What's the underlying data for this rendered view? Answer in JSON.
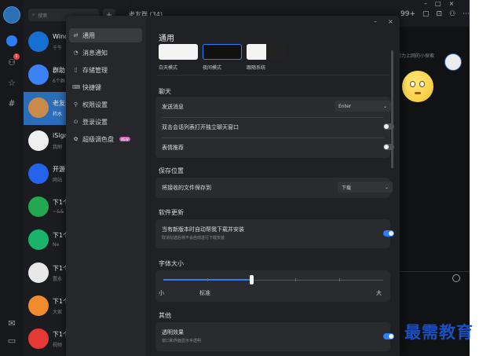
{
  "colors": {
    "accent": "#2e7cf6",
    "badge": "#e54545",
    "panel": "#202124",
    "nav": "#26272b"
  },
  "rail": {
    "unread_badge": "1"
  },
  "search": {
    "placeholder": "搜索"
  },
  "conversations": [
    {
      "name": "Wind",
      "preview": "千牛"
    },
    {
      "name": "群助",
      "preview": "6个群"
    },
    {
      "name": "老友",
      "preview": "药水"
    },
    {
      "name": "iSign",
      "preview": "我刷"
    },
    {
      "name": "开源",
      "preview": "网站"
    },
    {
      "name": "下1个",
      "preview": "~&&"
    },
    {
      "name": "下1个",
      "preview": "Ne"
    },
    {
      "name": "下1个",
      "preview": "置永"
    },
    {
      "name": "下1个",
      "preview": "大家"
    },
    {
      "name": "下1个",
      "preview": "视频"
    }
  ],
  "chat": {
    "title": "老友群 (34)",
    "counter": "99+",
    "side_text": "努力上网的小探索"
  },
  "settings": {
    "nav": [
      {
        "icon": "general-icon",
        "label": "通用"
      },
      {
        "icon": "bell-icon",
        "label": "消息通知"
      },
      {
        "icon": "storage-icon",
        "label": "存储管理"
      },
      {
        "icon": "keyboard-icon",
        "label": "快捷键"
      },
      {
        "icon": "lock-icon",
        "label": "权限设置"
      },
      {
        "icon": "login-icon",
        "label": "登录设置"
      },
      {
        "icon": "palette-icon",
        "label": "超级调色盘",
        "tag": "NEW"
      }
    ],
    "title": "通用",
    "themes": [
      {
        "label": "白天模式"
      },
      {
        "label": "夜间模式",
        "selected": true
      },
      {
        "label": "跟随系统"
      }
    ],
    "chat_section": {
      "title": "聊天",
      "send_label": "发送消息",
      "send_value": "Enter",
      "dblclick_label": "双击会话列表打开独立聊天窗口",
      "dblclick_on": false,
      "emoji_label": "表情推荐",
      "emoji_on": false
    },
    "save_section": {
      "title": "保存位置",
      "path_label": "将接收的文件保存到",
      "path_value": "下载"
    },
    "update_section": {
      "title": "软件更新",
      "auto_label": "当有新版本时自动帮我下载并安装",
      "auto_sub": "取消勾选后将不会自动进行下载安装",
      "auto_on": true
    },
    "font_section": {
      "title": "字体大小",
      "min": "小",
      "mid": "标准",
      "max": "大",
      "level": 0.4
    },
    "other_section": {
      "title": "其他",
      "transparent_label": "透明效果",
      "transparent_sub": "窗口和界面显示半透明",
      "transparent_on": true
    }
  },
  "watermark": "最需教育"
}
